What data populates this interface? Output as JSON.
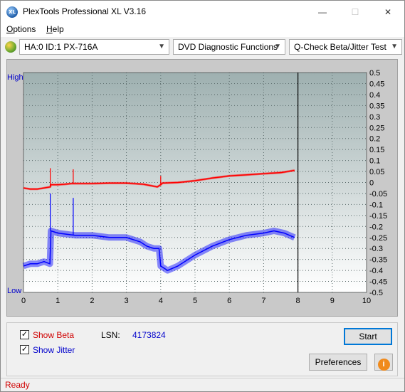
{
  "window": {
    "title": "PlexTools Professional XL V3.16",
    "icon_text": "XL"
  },
  "controls": {
    "minimize": "—",
    "maximize": "☐",
    "close": "✕"
  },
  "menu": {
    "items": [
      {
        "label": "Options",
        "key": "O",
        "rest": "ptions"
      },
      {
        "label": "Help",
        "key": "H",
        "rest": "elp"
      }
    ]
  },
  "toolbar": {
    "drive": "HA:0 ID:1  PX-716A",
    "function": "DVD Diagnostic Functions",
    "test": "Q-Check Beta/Jitter Test"
  },
  "chart": {
    "left_top_label": "High",
    "left_bottom_label": "Low",
    "x_ticks": [
      "0",
      "1",
      "2",
      "3",
      "4",
      "5",
      "6",
      "7",
      "8",
      "9",
      "10"
    ],
    "y_ticks": [
      "0.5",
      "0.45",
      "0.4",
      "0.35",
      "0.3",
      "0.25",
      "0.2",
      "0.15",
      "0.1",
      "0.05",
      "0",
      "-0.05",
      "-0.1",
      "-0.15",
      "-0.2",
      "-0.25",
      "-0.3",
      "-0.35",
      "-0.4",
      "-0.45",
      "-0.5"
    ],
    "colors": {
      "beta": "#ff0000",
      "jitter": "#0000ff",
      "bg_top": "#9fb0b0",
      "bg_bottom": "#ffffff"
    }
  },
  "chart_data": {
    "type": "line",
    "xlim": [
      0,
      10
    ],
    "ylim": [
      -0.5,
      0.5
    ],
    "marker_x": 8,
    "series": [
      {
        "name": "Beta",
        "color": "#ff0000",
        "x": [
          0,
          0.2,
          0.4,
          0.6,
          0.78,
          0.8,
          1.0,
          1.2,
          1.4,
          1.6,
          2.0,
          2.5,
          3.0,
          3.5,
          3.9,
          4.0,
          4.05,
          4.5,
          5.0,
          5.5,
          6.0,
          6.5,
          7.0,
          7.5,
          7.9
        ],
        "y": [
          -0.025,
          -0.03,
          -0.03,
          -0.025,
          -0.02,
          -0.01,
          -0.01,
          -0.008,
          -0.005,
          -0.005,
          -0.005,
          -0.003,
          -0.003,
          -0.008,
          -0.02,
          -0.01,
          -0.003,
          0.0,
          0.008,
          0.02,
          0.03,
          0.035,
          0.04,
          0.045,
          0.055
        ],
        "spikes": [
          {
            "x": 0.78,
            "y": 0.065
          },
          {
            "x": 1.45,
            "y": 0.06
          },
          {
            "x": 4.0,
            "y": 0.03
          }
        ]
      },
      {
        "name": "Jitter",
        "color": "#0000ff",
        "x": [
          0,
          0.2,
          0.4,
          0.6,
          0.77,
          0.8,
          1.0,
          1.5,
          2.0,
          2.5,
          3.0,
          3.4,
          3.6,
          3.8,
          3.95,
          4.0,
          4.2,
          4.5,
          5.0,
          5.5,
          6.0,
          6.5,
          7.0,
          7.3,
          7.6,
          7.9
        ],
        "y": [
          -0.38,
          -0.37,
          -0.37,
          -0.36,
          -0.37,
          -0.22,
          -0.23,
          -0.24,
          -0.24,
          -0.25,
          -0.25,
          -0.27,
          -0.29,
          -0.3,
          -0.3,
          -0.38,
          -0.4,
          -0.38,
          -0.33,
          -0.29,
          -0.26,
          -0.24,
          -0.23,
          -0.22,
          -0.23,
          -0.25
        ],
        "spikes": [
          {
            "x": 0.78,
            "y": -0.05
          },
          {
            "x": 1.45,
            "y": -0.07
          }
        ]
      }
    ]
  },
  "bottom": {
    "show_beta": {
      "label": "Show Beta",
      "checked": "✓"
    },
    "show_jitter": {
      "label": "Show Jitter",
      "checked": "✓"
    },
    "lsn_label": "LSN:",
    "lsn_value": "4173824",
    "start": "Start",
    "preferences": "Preferences",
    "info_icon": "i"
  },
  "status": {
    "text": "Ready"
  }
}
